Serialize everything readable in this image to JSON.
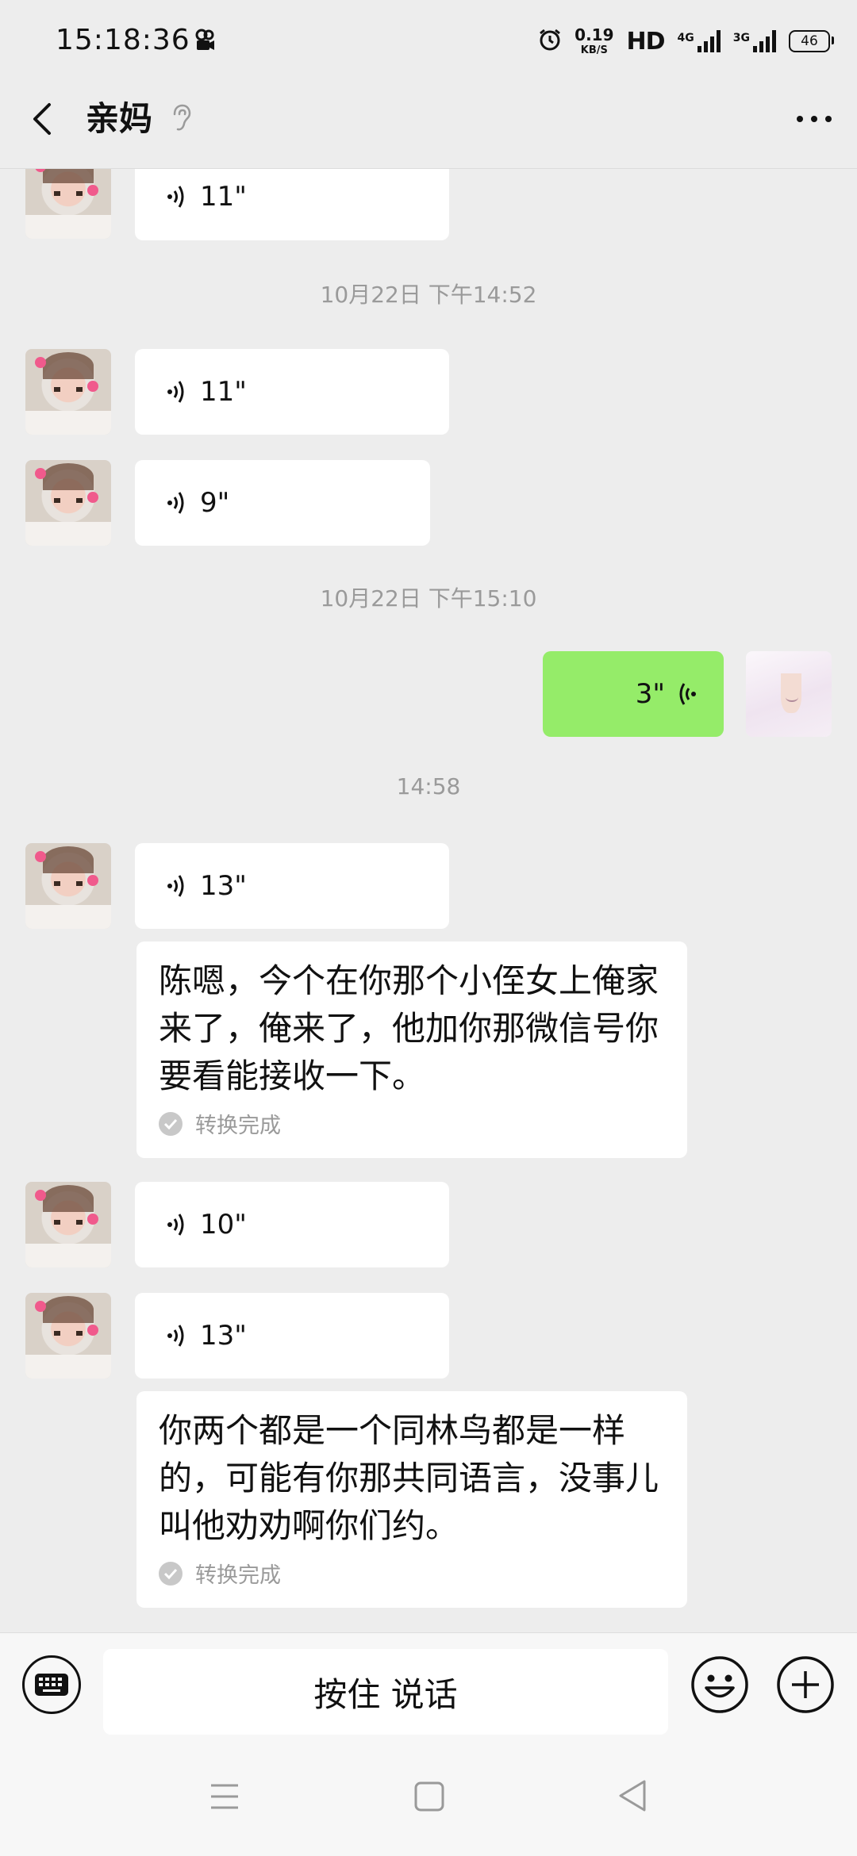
{
  "status_bar": {
    "time": "15:18:36",
    "net_speed_value": "0.19",
    "net_speed_unit": "KB/S",
    "hd_label": "HD",
    "signal1_label": "4G",
    "signal2_label": "3G",
    "battery_level": "46"
  },
  "header": {
    "title": "亲妈"
  },
  "messages": [
    {
      "type": "voice",
      "from": "other",
      "duration": "11\""
    },
    {
      "type": "timestamp",
      "text": "10月22日 下午14:52"
    },
    {
      "type": "voice",
      "from": "other",
      "duration": "11\""
    },
    {
      "type": "voice",
      "from": "other",
      "duration": "9\""
    },
    {
      "type": "timestamp",
      "text": "10月22日 下午15:10"
    },
    {
      "type": "voice",
      "from": "self",
      "duration": "3\""
    },
    {
      "type": "timestamp",
      "text": "14:58"
    },
    {
      "type": "voice",
      "from": "other",
      "duration": "13\""
    },
    {
      "type": "transcription",
      "text": "陈嗯，今个在你那个小侄女上俺家来了，俺来了，他加你那微信号你要看能接收一下。",
      "status": "转换完成"
    },
    {
      "type": "voice",
      "from": "other",
      "duration": "10\""
    },
    {
      "type": "voice",
      "from": "other",
      "duration": "13\""
    },
    {
      "type": "transcription",
      "text": "你两个都是一个同林鸟都是一样的，可能有你那共同语言，没事儿叫他劝劝啊你们约。",
      "status": "转换完成"
    }
  ],
  "input_bar": {
    "hold_to_talk_label": "按住 说话"
  },
  "colors": {
    "background": "#ededed",
    "self_bubble": "#95ec69",
    "other_bubble": "#ffffff",
    "timestamp_text": "#9a9a9a"
  },
  "icons": {
    "back": "chevron-left-icon",
    "ear": "ear-icon",
    "more": "more-dots-icon",
    "voice": "voice-wave-icon",
    "keyboard": "keyboard-icon",
    "emoji": "emoji-icon",
    "plus": "plus-icon",
    "check": "check-icon"
  }
}
